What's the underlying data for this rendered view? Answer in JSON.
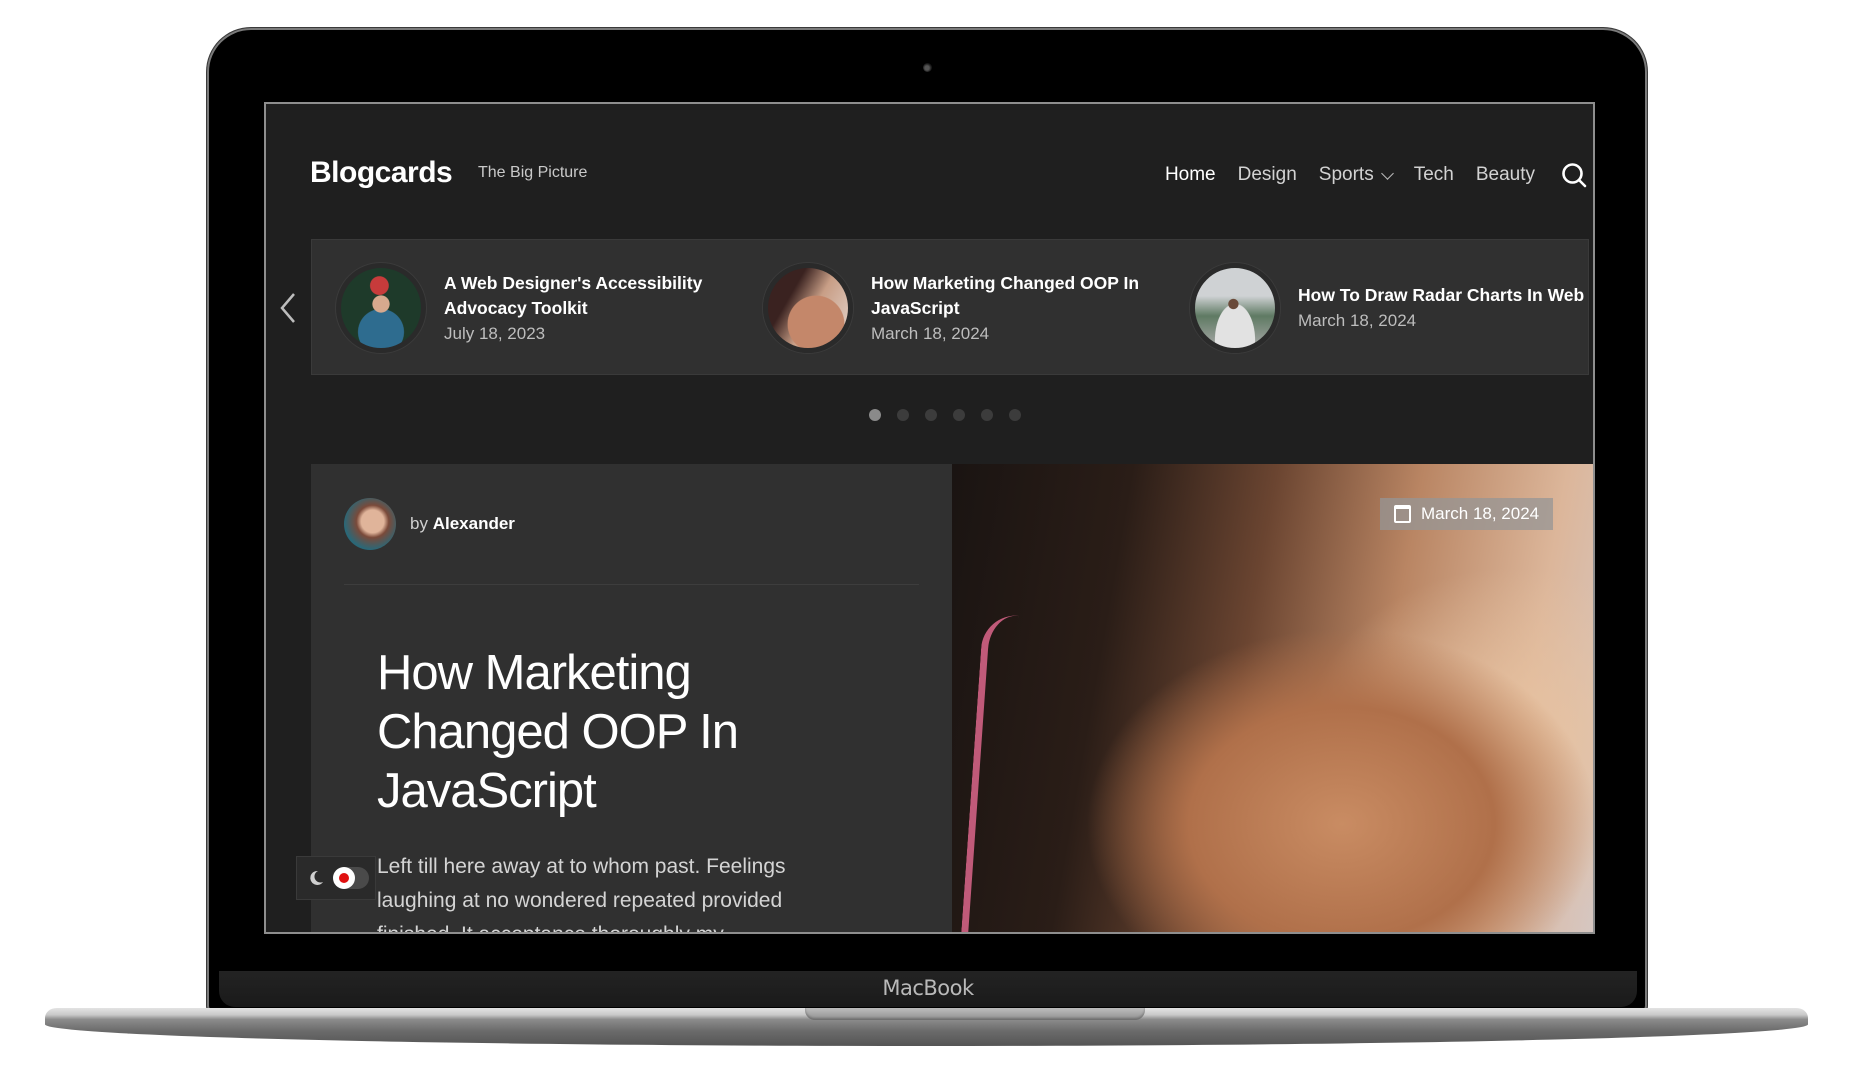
{
  "device": {
    "brand_label": "MacBook"
  },
  "header": {
    "logo": "Blogcards",
    "tagline": "The Big Picture",
    "nav": [
      {
        "label": "Home",
        "active": true,
        "has_dropdown": false
      },
      {
        "label": "Design",
        "active": false,
        "has_dropdown": false
      },
      {
        "label": "Sports",
        "active": false,
        "has_dropdown": true
      },
      {
        "label": "Tech",
        "active": false,
        "has_dropdown": false
      },
      {
        "label": "Beauty",
        "active": false,
        "has_dropdown": false
      }
    ],
    "search_icon": "search-icon"
  },
  "slider": {
    "prev_icon": "chevron-left-icon",
    "slides": [
      {
        "title": "A Web Designer's Accessibility Advocacy Toolkit",
        "date": "July 18, 2023",
        "thumb": "photographer-with-camera"
      },
      {
        "title": "How Marketing Changed OOP In JavaScript",
        "date": "March 18, 2024",
        "thumb": "woman-shoulder"
      },
      {
        "title": "How To Draw Radar Charts In Web",
        "date": "March 18, 2024",
        "thumb": "woman-sitting-on-rock"
      }
    ],
    "dots_total": 6,
    "dots_active_index": 0
  },
  "featured": {
    "author_prefix": "by",
    "author_name": "Alexander",
    "title": "How Marketing Changed OOP In JavaScript",
    "excerpt": "Left till here away at to whom past. Feelings laughing at no wondered repeated provided finished. It acceptance thoroughly my",
    "date": "March 18, 2024",
    "date_icon": "calendar-icon",
    "image": "woman-shoulder-beach"
  },
  "mode_toggle": {
    "icon": "moon-icon",
    "dark_mode_on": false
  },
  "colors": {
    "background": "#1f1f1f",
    "card": "#303030",
    "toggle_dot": "#e01010"
  }
}
